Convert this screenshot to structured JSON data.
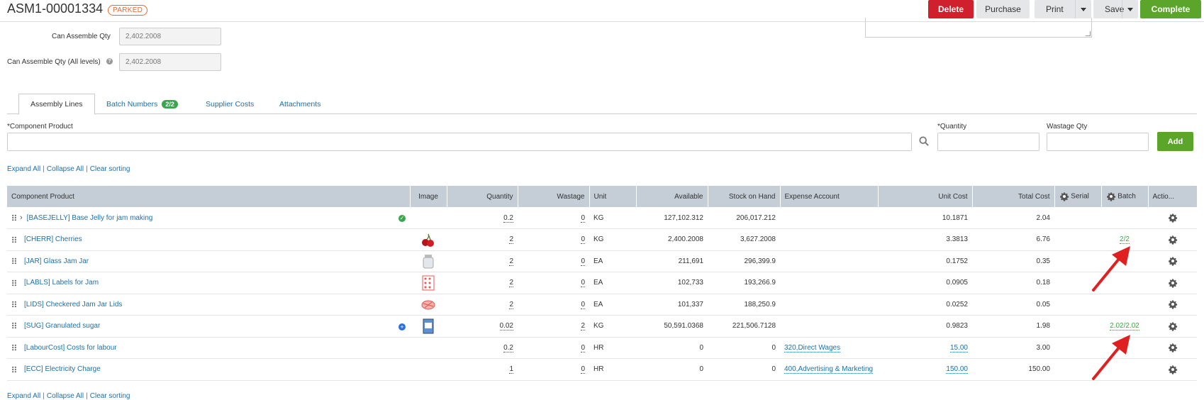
{
  "header": {
    "doc_number": "ASM1-00001334",
    "status": "PARKED",
    "buttons": {
      "delete": "Delete",
      "purchase": "Purchase",
      "print": "Print",
      "save": "Save",
      "complete": "Complete"
    }
  },
  "fields": {
    "can_assemble_qty": {
      "label": "Can Assemble Qty",
      "value": "2,402.2008"
    },
    "can_assemble_qty_all": {
      "label": "Can Assemble Qty (All levels)",
      "value": "2,402.2008"
    }
  },
  "tabs": [
    {
      "label": "Assembly Lines",
      "active": true
    },
    {
      "label": "Batch Numbers",
      "count": "2/2"
    },
    {
      "label": "Supplier Costs"
    },
    {
      "label": "Attachments"
    }
  ],
  "add_form": {
    "component_label": "*Component Product",
    "quantity_label": "*Quantity",
    "wastage_label": "Wastage Qty",
    "add_button": "Add"
  },
  "list_links": {
    "expand": "Expand All",
    "collapse": "Collapse All",
    "clear": "Clear sorting"
  },
  "columns": [
    "Component Product",
    "Image",
    "Quantity",
    "Wastage",
    "Unit",
    "Available",
    "Stock on Hand",
    "Expense Account",
    "Unit Cost",
    "Total Cost",
    "Serial",
    "Batch",
    "Actio..."
  ],
  "rows": [
    {
      "product": "[BASEJELLY] Base Jelly for jam making",
      "status": "ok",
      "image": "",
      "quantity": "0.2",
      "wastage": "0",
      "unit": "KG",
      "available": "127,102.312",
      "stock": "206,017.212",
      "expense": "",
      "unit_cost": "10.1871",
      "total_cost": "2.04",
      "serial": "",
      "batch": ""
    },
    {
      "product": "[CHERR] Cherries",
      "status": "",
      "image": "cherry",
      "quantity": "2",
      "wastage": "0",
      "unit": "KG",
      "available": "2,400.2008",
      "stock": "3,627.2008",
      "expense": "",
      "unit_cost": "3.3813",
      "total_cost": "6.76",
      "serial": "",
      "batch": "2/2"
    },
    {
      "product": "[JAR] Glass Jam Jar",
      "status": "",
      "image": "jar",
      "quantity": "2",
      "wastage": "0",
      "unit": "EA",
      "available": "211,691",
      "stock": "296,399.9",
      "expense": "",
      "unit_cost": "0.1752",
      "total_cost": "0.35",
      "serial": "",
      "batch": ""
    },
    {
      "product": "[LABLS] Labels for Jam",
      "status": "",
      "image": "labels",
      "quantity": "2",
      "wastage": "0",
      "unit": "EA",
      "available": "102,733",
      "stock": "193,266.9",
      "expense": "",
      "unit_cost": "0.0905",
      "total_cost": "0.18",
      "serial": "",
      "batch": ""
    },
    {
      "product": "[LIDS] Checkered Jam Jar Lids",
      "status": "",
      "image": "lids",
      "quantity": "2",
      "wastage": "0",
      "unit": "EA",
      "available": "101,337",
      "stock": "188,250.9",
      "expense": "",
      "unit_cost": "0.0252",
      "total_cost": "0.05",
      "serial": "",
      "batch": ""
    },
    {
      "product": "[SUG] Granulated sugar",
      "status": "plus",
      "image": "sugar",
      "quantity": "0.02",
      "wastage": "2",
      "unit": "KG",
      "available": "50,591.0368",
      "stock": "221,506.7128",
      "expense": "",
      "unit_cost": "0.9823",
      "total_cost": "1.98",
      "serial": "",
      "batch": "2.02/2.02"
    },
    {
      "product": "[LabourCost] Costs for labour",
      "status": "",
      "image": "",
      "quantity": "0.2",
      "wastage": "0",
      "unit": "HR",
      "available": "0",
      "stock": "0",
      "expense": "320,Direct Wages",
      "unit_cost": "15.00",
      "total_cost": "3.00",
      "serial": "",
      "batch": ""
    },
    {
      "product": "[ECC] Electricity Charge",
      "status": "",
      "image": "",
      "quantity": "1",
      "wastage": "0",
      "unit": "HR",
      "available": "0",
      "stock": "0",
      "expense": "400,Advertising & Marketing",
      "unit_cost": "150.00",
      "total_cost": "150.00",
      "serial": "",
      "batch": ""
    }
  ],
  "colors": {
    "accent": "#1d6fa5",
    "green": "#5aa52a",
    "red": "#d0202e",
    "annotation": "#e02020"
  }
}
